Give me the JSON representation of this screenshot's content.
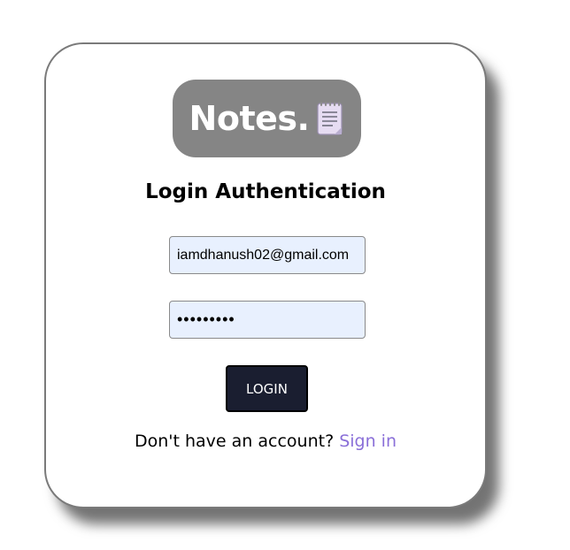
{
  "logo": {
    "text": "Notes.",
    "icon": "notepad-icon"
  },
  "login": {
    "title": "Login Authentication",
    "email_value": "iamdhanush02@gmail.com",
    "password_value": "•••••••••",
    "button_label": "LOGIN"
  },
  "signup": {
    "prompt": "Don't have an account?",
    "link_label": "Sign in"
  },
  "colors": {
    "logo_background": "#858585",
    "button_background": "#1a1e30",
    "link": "#8a6fd8",
    "input_background": "#e8f0fe"
  }
}
